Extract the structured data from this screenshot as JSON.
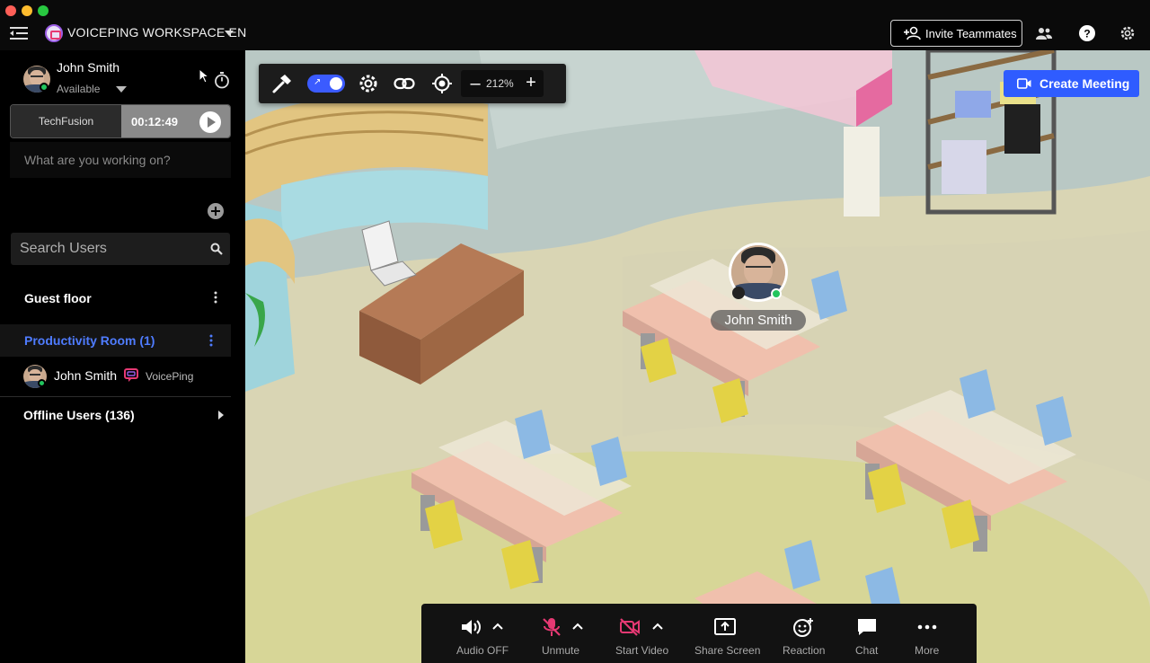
{
  "window": {
    "workspace_title": "VOICEPING WORKSPACE EN"
  },
  "header": {
    "invite_label": "Invite Teammates",
    "icons": [
      "people-icon",
      "help-icon",
      "settings-icon"
    ]
  },
  "user": {
    "name": "John Smith",
    "status": "Available",
    "status_color": "#22c55e"
  },
  "timer": {
    "project": "TechFusion",
    "elapsed": "00:12:49"
  },
  "working_input": {
    "placeholder": "What are you working on?"
  },
  "search": {
    "placeholder": "Search Users"
  },
  "floors": {
    "guest_floor": "Guest floor",
    "room": "Productivity Room (1)",
    "room_member": "John Smith",
    "room_member_app": "VoicePing",
    "offline": "Offline Users (136)"
  },
  "map_toolbar": {
    "zoom": "212%",
    "minus": "–",
    "plus": "+"
  },
  "map": {
    "create_meeting": "Create Meeting",
    "avatar_name": "John Smith",
    "accent_color": "#2f5cff"
  },
  "controls": {
    "audio": "Audio OFF",
    "unmute": "Unmute",
    "video": "Start Video",
    "share": "Share Screen",
    "reaction": "Reaction",
    "chat": "Chat",
    "more": "More",
    "alert_color": "#e63973"
  }
}
